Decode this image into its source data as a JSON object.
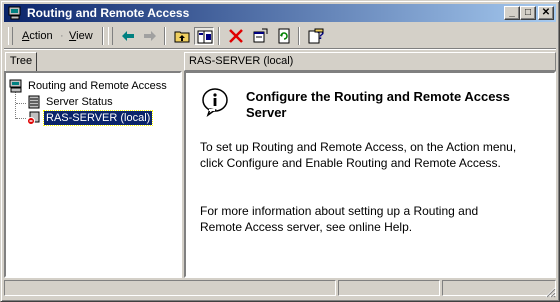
{
  "window": {
    "title": "Routing and Remote Access",
    "controls": {
      "minimize": "_",
      "maximize": "□",
      "close": "✕"
    }
  },
  "menubar": {
    "items": [
      {
        "label_prefix": "",
        "underline": "A",
        "label_suffix": "ction"
      },
      {
        "label_prefix": "",
        "underline": "V",
        "label_suffix": "iew"
      }
    ],
    "dot": "·"
  },
  "toolbar": {
    "icons": [
      "back-arrow-icon",
      "forward-arrow-icon",
      "up-folder-icon",
      "show-hide-tree-icon",
      "delete-icon",
      "properties-icon",
      "refresh-icon",
      "help-icon"
    ]
  },
  "tree": {
    "tab_label": "Tree",
    "root": "Routing and Remote Access",
    "children": [
      "Server Status",
      "RAS-SERVER (local)"
    ]
  },
  "content": {
    "header": "RAS-SERVER (local)",
    "heading": "Configure the Routing and Remote Access Server",
    "paragraph1": "To set up Routing and Remote Access, on the Action menu, click Configure and Enable Routing and Remote Access.",
    "paragraph2": "For more information about setting up a Routing and Remote Access server, see online Help."
  },
  "colors": {
    "titlebar_start": "#0a246a",
    "titlebar_end": "#a6caf0",
    "selection": "#0a246a",
    "face": "#d4d0c8"
  }
}
